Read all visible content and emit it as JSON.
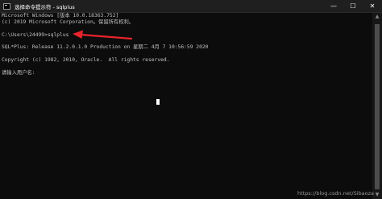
{
  "window": {
    "title": "选择命令提示符 - sqlplus"
  },
  "controls": {
    "minimize": "—",
    "maximize": "☐",
    "close": "✕"
  },
  "console": {
    "lines": [
      "Microsoft Windows [版本 10.0.18363.752]",
      "(c) 2019 Microsoft Corporation。保留所有权利。",
      "",
      "C:\\Users\\24499>sqlplus",
      "",
      "SQL*Plus: Release 11.2.0.1.0 Production on 星期二 4月 7 10:56:59 2020",
      "",
      "Copyright (c) 1982, 2010, Oracle.  All rights reserved.",
      "",
      "请输入用户名:"
    ]
  },
  "scrollbar": {
    "up": "▲",
    "down": "▼"
  },
  "annotation": {
    "arrow_color": "#e8232b"
  },
  "watermark": {
    "text": "https://blog.csdn.net/Sibaoza"
  }
}
